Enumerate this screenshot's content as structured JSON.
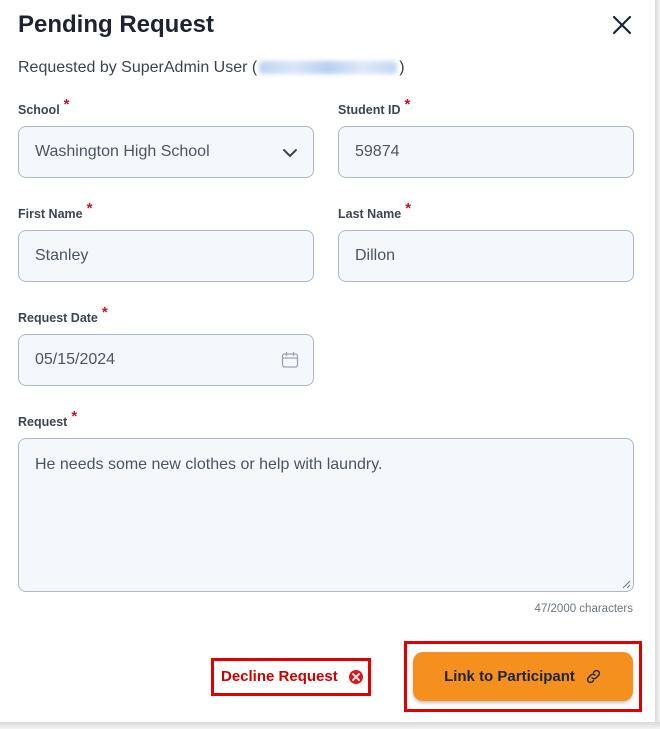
{
  "modal": {
    "title": "Pending Request",
    "subtitle_prefix": "Requested by SuperAdmin User (",
    "subtitle_suffix": ")"
  },
  "fields": {
    "school": {
      "label": "School",
      "value": "Washington High School"
    },
    "student_id": {
      "label": "Student ID",
      "value": "59874"
    },
    "first_name": {
      "label": "First Name",
      "value": "Stanley"
    },
    "last_name": {
      "label": "Last Name",
      "value": "Dillon"
    },
    "request_date": {
      "label": "Request Date",
      "value": "05/15/2024"
    },
    "request": {
      "label": "Request",
      "value": "He needs some new clothes or help with laundry.",
      "counter": "47/2000 characters"
    }
  },
  "required_marker": "*",
  "actions": {
    "decline_label": "Decline Request",
    "link_label": "Link to Participant"
  },
  "colors": {
    "accent": "#f5901f",
    "danger": "#cc0000",
    "highlight": "#e00000",
    "field_bg": "#f5f8fb",
    "field_border": "#aab8c8"
  },
  "icons": {
    "close": "close-icon",
    "dropdown": "chevron-down-icon",
    "calendar": "calendar-icon",
    "decline": "x-circle-icon",
    "link": "link-icon"
  }
}
